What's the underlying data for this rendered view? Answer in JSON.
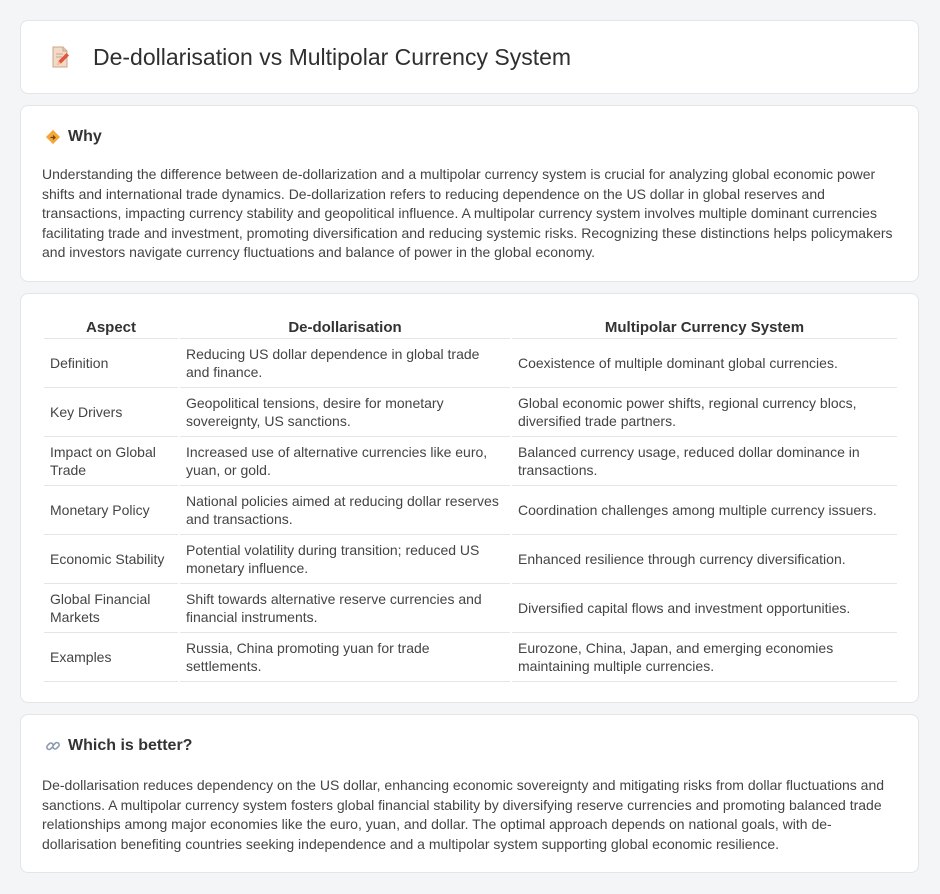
{
  "header": {
    "title": "De-dollarisation vs Multipolar Currency System",
    "icon": "document-pencil-icon"
  },
  "why": {
    "title": "Why",
    "icon": "diamond-sign-icon",
    "text": "Understanding the difference between de-dollarization and a multipolar currency system is crucial for analyzing global economic power shifts and international trade dynamics. De-dollarization refers to reducing dependence on the US dollar in global reserves and transactions, impacting currency stability and geopolitical influence. A multipolar currency system involves multiple dominant currencies facilitating trade and investment, promoting diversification and reducing systemic risks. Recognizing these distinctions helps policymakers and investors navigate currency fluctuations and balance of power in the global economy."
  },
  "table": {
    "headers": [
      "Aspect",
      "De-dollarisation",
      "Multipolar Currency System"
    ],
    "rows": [
      [
        "Definition",
        "Reducing US dollar dependence in global trade and finance.",
        "Coexistence of multiple dominant global currencies."
      ],
      [
        "Key Drivers",
        "Geopolitical tensions, desire for monetary sovereignty, US sanctions.",
        "Global economic power shifts, regional currency blocs, diversified trade partners."
      ],
      [
        "Impact on Global Trade",
        "Increased use of alternative currencies like euro, yuan, or gold.",
        "Balanced currency usage, reduced dollar dominance in transactions."
      ],
      [
        "Monetary Policy",
        "National policies aimed at reducing dollar reserves and transactions.",
        "Coordination challenges among multiple currency issuers."
      ],
      [
        "Economic Stability",
        "Potential volatility during transition; reduced US monetary influence.",
        "Enhanced resilience through currency diversification."
      ],
      [
        "Global Financial Markets",
        "Shift towards alternative reserve currencies and financial instruments.",
        "Diversified capital flows and investment opportunities."
      ],
      [
        "Examples",
        "Russia, China promoting yuan for trade settlements.",
        "Eurozone, China, Japan, and emerging economies maintaining multiple currencies."
      ]
    ]
  },
  "better": {
    "title": "Which is better?",
    "icon": "link-icon",
    "text": "De-dollarisation reduces dependency on the US dollar, enhancing economic sovereignty and mitigating risks from dollar fluctuations and sanctions. A multipolar currency system fosters global financial stability by diversifying reserve currencies and promoting balanced trade relationships among major economies like the euro, yuan, and dollar. The optimal approach depends on national goals, with de-dollarisation benefiting countries seeking independence and a multipolar system supporting global economic resilience."
  }
}
